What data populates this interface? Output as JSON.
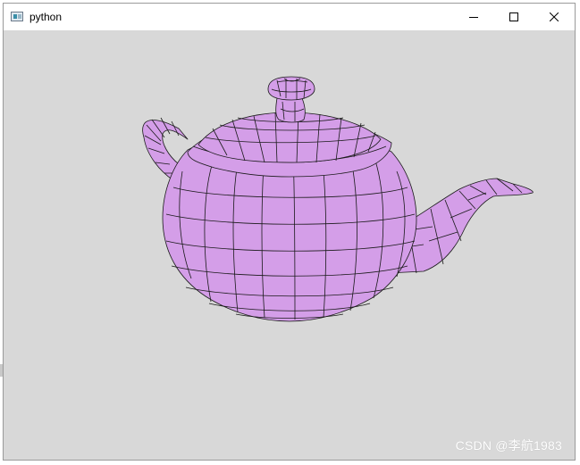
{
  "window": {
    "title": "python",
    "icon": "python-app-icon"
  },
  "controls": {
    "minimize_icon": "minimize-icon",
    "maximize_icon": "maximize-icon",
    "close_icon": "close-icon"
  },
  "canvas": {
    "background": "#d8d8d8",
    "model": "teapot-wireframe",
    "fill_color": "#d49ee8",
    "wire_color": "#1a1a1a"
  },
  "watermark": {
    "text": "CSDN @李航1983"
  }
}
